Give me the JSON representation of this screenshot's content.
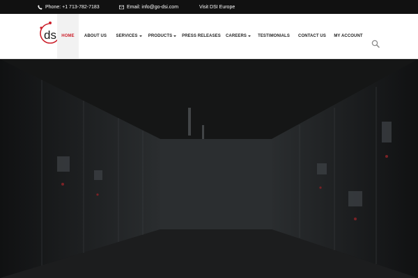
{
  "topbar": {
    "phone": "Phone: +1 713-782-7183",
    "email": "Email: info@go-dsi.com",
    "europe": "Visit DSI Europe"
  },
  "logo": {
    "text": "ds"
  },
  "nav": {
    "items": [
      {
        "label": "HOME",
        "active": true,
        "dropdown": false
      },
      {
        "label": "ABOUT US",
        "active": false,
        "dropdown": false
      },
      {
        "label": "SERVICES",
        "active": false,
        "dropdown": true
      },
      {
        "label": "PRODUCTS",
        "active": false,
        "dropdown": true
      },
      {
        "label": "PRESS RELEASES",
        "active": false,
        "dropdown": false
      },
      {
        "label": "CAREERS",
        "active": false,
        "dropdown": true
      },
      {
        "label": "TESTIMONIALS",
        "active": false,
        "dropdown": false
      },
      {
        "label": "CONTACT US",
        "active": false,
        "dropdown": false
      },
      {
        "label": "MY ACCOUNT",
        "active": false,
        "dropdown": false
      }
    ]
  },
  "colors": {
    "accent": "#cc1f2a",
    "topbar": "#111111",
    "header": "#ffffff"
  },
  "icons": [
    "phone-icon",
    "envelope-icon",
    "search-icon"
  ]
}
